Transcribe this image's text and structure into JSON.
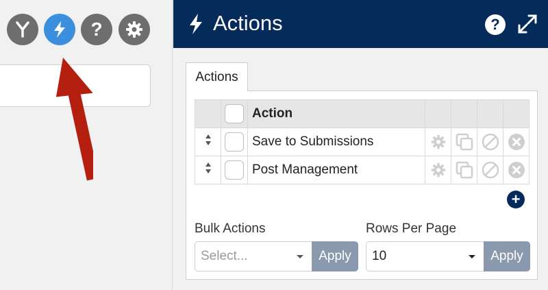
{
  "toolbar": {
    "buttons": [
      {
        "icon": "merge-icon",
        "active": false
      },
      {
        "icon": "bolt-icon",
        "active": true
      },
      {
        "icon": "help-icon",
        "active": false
      },
      {
        "icon": "gear-icon",
        "active": false
      }
    ],
    "help_glyph": "?"
  },
  "panel": {
    "title": "Actions",
    "help_glyph": "?",
    "tab_label": "Actions",
    "table": {
      "header": "Action",
      "rows": [
        {
          "label": "Save to Submissions"
        },
        {
          "label": "Post Management"
        }
      ]
    },
    "add_glyph": "+",
    "bulk_actions": {
      "label": "Bulk Actions",
      "placeholder": "Select...",
      "apply_label": "Apply"
    },
    "rows_per_page": {
      "label": "Rows Per Page",
      "value": "10",
      "apply_label": "Apply"
    }
  },
  "colors": {
    "header_bg": "#052b5b",
    "active_button": "#3c8fdd",
    "inactive_button": "#6e6e6e",
    "apply_button": "#8b99ae",
    "arrow": "#b51f10"
  }
}
